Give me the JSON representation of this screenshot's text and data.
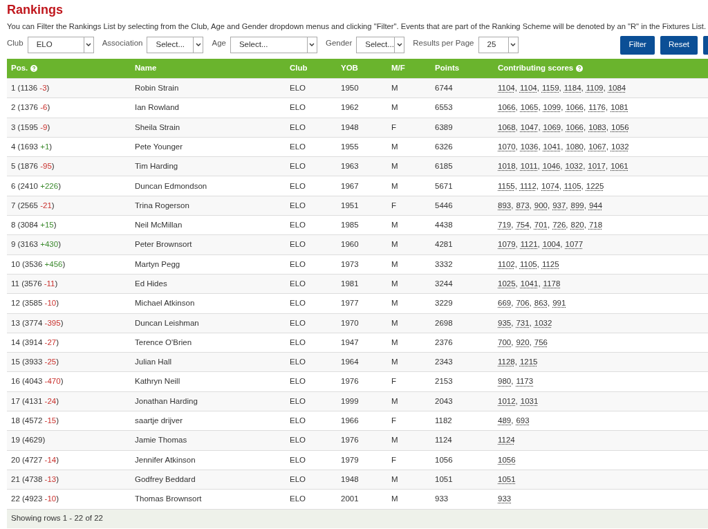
{
  "title": "Rankings",
  "intro": "You can Filter the Rankings List by selecting from the Club, Age and Gender dropdown menus and clicking \"Filter\". Events that are part of the Ranking Scheme will be denoted by an \"R\" in the Fixtures List.",
  "filters": [
    {
      "label": "Club",
      "value": "ELO"
    },
    {
      "label": "Association",
      "value": "Select..."
    },
    {
      "label": "Age",
      "value": "Select..."
    },
    {
      "label": "Gender",
      "value": "Select..."
    },
    {
      "label": "Results per Page",
      "value": "25"
    }
  ],
  "buttons": [
    "Filter",
    "Reset"
  ],
  "columns": [
    {
      "label": "Pos.",
      "help": true
    },
    {
      "label": "Name",
      "help": false
    },
    {
      "label": "Club",
      "help": false
    },
    {
      "label": "YOB",
      "help": false
    },
    {
      "label": "M/F",
      "help": false
    },
    {
      "label": "Points",
      "help": false
    },
    {
      "label": "Contributing scores",
      "help": true
    }
  ],
  "rows": [
    {
      "position": "1 (1136",
      "change": "-3",
      "kind": "down",
      "close": ")",
      "name": "Robin Strain",
      "club": "ELO",
      "yob": "1950",
      "sex": "M",
      "points": "6744",
      "scores": [
        {
          "value": "1104",
          "sep": ","
        },
        {
          "value": "1104",
          "sep": ","
        },
        {
          "value": "1159",
          "sep": ","
        },
        {
          "value": "1184",
          "sep": ","
        },
        {
          "value": "1109",
          "sep": ","
        },
        {
          "value": "1084"
        }
      ]
    },
    {
      "position": "2 (1376",
      "change": "-6",
      "kind": "down",
      "close": ")",
      "name": "Ian Rowland",
      "club": "ELO",
      "yob": "1962",
      "sex": "M",
      "points": "6553",
      "scores": [
        {
          "value": "1066",
          "sep": ","
        },
        {
          "value": "1065",
          "sep": ","
        },
        {
          "value": "1099",
          "sep": ","
        },
        {
          "value": "1066",
          "sep": ","
        },
        {
          "value": "1176",
          "sep": ","
        },
        {
          "value": "1081"
        }
      ]
    },
    {
      "position": "3 (1595",
      "change": "-9",
      "kind": "down",
      "close": ")",
      "name": "Sheila Strain",
      "club": "ELO",
      "yob": "1948",
      "sex": "F",
      "points": "6389",
      "scores": [
        {
          "value": "1068",
          "sep": ","
        },
        {
          "value": "1047",
          "sep": ","
        },
        {
          "value": "1069",
          "sep": ","
        },
        {
          "value": "1066",
          "sep": ","
        },
        {
          "value": "1083",
          "sep": ","
        },
        {
          "value": "1056"
        }
      ]
    },
    {
      "position": "4 (1693",
      "change": "+1",
      "kind": "up",
      "close": ")",
      "name": "Pete Younger",
      "club": "ELO",
      "yob": "1955",
      "sex": "M",
      "points": "6326",
      "scores": [
        {
          "value": "1070",
          "sep": ","
        },
        {
          "value": "1036",
          "sep": ","
        },
        {
          "value": "1041",
          "sep": ","
        },
        {
          "value": "1080",
          "sep": ","
        },
        {
          "value": "1067",
          "sep": ","
        },
        {
          "value": "1032"
        }
      ]
    },
    {
      "position": "5 (1876",
      "change": "-95",
      "kind": "down",
      "close": ")",
      "name": "Tim Harding",
      "club": "ELO",
      "yob": "1963",
      "sex": "M",
      "points": "6185",
      "scores": [
        {
          "value": "1018",
          "sep": ","
        },
        {
          "value": "1011",
          "sep": ","
        },
        {
          "value": "1046",
          "sep": ","
        },
        {
          "value": "1032",
          "sep": ","
        },
        {
          "value": "1017",
          "sep": ","
        },
        {
          "value": "1061"
        }
      ]
    },
    {
      "position": "6 (2410",
      "change": "+226",
      "kind": "up",
      "close": ")",
      "name": "Duncan Edmondson",
      "club": "ELO",
      "yob": "1967",
      "sex": "M",
      "points": "5671",
      "scores": [
        {
          "value": "1155",
          "sep": ","
        },
        {
          "value": "1112",
          "sep": ","
        },
        {
          "value": "1074",
          "sep": ","
        },
        {
          "value": "1105",
          "sep": ","
        },
        {
          "value": "1225"
        }
      ]
    },
    {
      "position": "7 (2565",
      "change": "-21",
      "kind": "down",
      "close": ")",
      "name": "Trina Rogerson",
      "club": "ELO",
      "yob": "1951",
      "sex": "F",
      "points": "5446",
      "scores": [
        {
          "value": "893",
          "sep": ","
        },
        {
          "value": "873",
          "sep": ","
        },
        {
          "value": "900",
          "sep": ","
        },
        {
          "value": "937",
          "sep": ","
        },
        {
          "value": "899",
          "sep": ","
        },
        {
          "value": "944"
        }
      ]
    },
    {
      "position": "8 (3084",
      "change": "+15",
      "kind": "up",
      "close": ")",
      "name": "Neil McMillan",
      "club": "ELO",
      "yob": "1985",
      "sex": "M",
      "points": "4438",
      "scores": [
        {
          "value": "719",
          "sep": ","
        },
        {
          "value": "754",
          "sep": ","
        },
        {
          "value": "701",
          "sep": ","
        },
        {
          "value": "726",
          "sep": ","
        },
        {
          "value": "820",
          "sep": ","
        },
        {
          "value": "718"
        }
      ]
    },
    {
      "position": "9 (3163",
      "change": "+430",
      "kind": "up",
      "close": ")",
      "name": "Peter Brownsort",
      "club": "ELO",
      "yob": "1960",
      "sex": "M",
      "points": "4281",
      "scores": [
        {
          "value": "1079",
          "sep": ","
        },
        {
          "value": "1121",
          "sep": ","
        },
        {
          "value": "1004",
          "sep": ","
        },
        {
          "value": "1077"
        }
      ]
    },
    {
      "position": "10 (3536",
      "change": "+456",
      "kind": "up",
      "close": ")",
      "name": "Martyn Pegg",
      "club": "ELO",
      "yob": "1973",
      "sex": "M",
      "points": "3332",
      "scores": [
        {
          "value": "1102",
          "sep": ","
        },
        {
          "value": "1105",
          "sep": ","
        },
        {
          "value": "1125"
        }
      ]
    },
    {
      "position": "11 (3576",
      "change": "-11",
      "kind": "down",
      "close": ")",
      "name": "Ed Hides",
      "club": "ELO",
      "yob": "1981",
      "sex": "M",
      "points": "3244",
      "scores": [
        {
          "value": "1025",
          "sep": ","
        },
        {
          "value": "1041",
          "sep": ","
        },
        {
          "value": "1178"
        }
      ]
    },
    {
      "position": "12 (3585",
      "change": "-10",
      "kind": "down",
      "close": ")",
      "name": "Michael Atkinson",
      "club": "ELO",
      "yob": "1977",
      "sex": "M",
      "points": "3229",
      "scores": [
        {
          "value": "669",
          "sep": ","
        },
        {
          "value": "706",
          "sep": ","
        },
        {
          "value": "863",
          "sep": ","
        },
        {
          "value": "991"
        }
      ]
    },
    {
      "position": "13 (3774",
      "change": "-395",
      "kind": "down",
      "close": ")",
      "name": "Duncan Leishman",
      "club": "ELO",
      "yob": "1970",
      "sex": "M",
      "points": "2698",
      "scores": [
        {
          "value": "935",
          "sep": ","
        },
        {
          "value": "731",
          "sep": ","
        },
        {
          "value": "1032"
        }
      ]
    },
    {
      "position": "14 (3914",
      "change": "-27",
      "kind": "down",
      "close": ")",
      "name": "Terence O'Brien",
      "club": "ELO",
      "yob": "1947",
      "sex": "M",
      "points": "2376",
      "scores": [
        {
          "value": "700",
          "sep": ","
        },
        {
          "value": "920",
          "sep": ","
        },
        {
          "value": "756"
        }
      ]
    },
    {
      "position": "15 (3933",
      "change": "-25",
      "kind": "down",
      "close": ")",
      "name": "Julian Hall",
      "club": "ELO",
      "yob": "1964",
      "sex": "M",
      "points": "2343",
      "scores": [
        {
          "value": "1128",
          "sep": ","
        },
        {
          "value": "1215"
        }
      ]
    },
    {
      "position": "16 (4043",
      "change": "-470",
      "kind": "down",
      "close": ")",
      "name": "Kathryn Neill",
      "club": "ELO",
      "yob": "1976",
      "sex": "F",
      "points": "2153",
      "scores": [
        {
          "value": "980",
          "sep": ","
        },
        {
          "value": "1173"
        }
      ]
    },
    {
      "position": "17 (4131",
      "change": "-24",
      "kind": "down",
      "close": ")",
      "name": "Jonathan Harding",
      "club": "ELO",
      "yob": "1999",
      "sex": "M",
      "points": "2043",
      "scores": [
        {
          "value": "1012",
          "sep": ","
        },
        {
          "value": "1031"
        }
      ]
    },
    {
      "position": "18 (4572",
      "change": "-15",
      "kind": "down",
      "close": ")",
      "name": "saartje drijver",
      "club": "ELO",
      "yob": "1966",
      "sex": "F",
      "points": "1182",
      "scores": [
        {
          "value": "489",
          "sep": ","
        },
        {
          "value": "693"
        }
      ]
    },
    {
      "position": "19 (4629)",
      "name": "Jamie Thomas",
      "club": "ELO",
      "yob": "1976",
      "sex": "M",
      "points": "1124",
      "scores": [
        {
          "value": "1124"
        }
      ]
    },
    {
      "position": "20 (4727",
      "change": "-14",
      "kind": "down",
      "close": ")",
      "name": "Jennifer Atkinson",
      "club": "ELO",
      "yob": "1979",
      "sex": "F",
      "points": "1056",
      "scores": [
        {
          "value": "1056"
        }
      ]
    },
    {
      "position": "21 (4738",
      "change": "-13",
      "kind": "down",
      "close": ")",
      "name": "Godfrey Beddard",
      "club": "ELO",
      "yob": "1948",
      "sex": "M",
      "points": "1051",
      "scores": [
        {
          "value": "1051"
        }
      ]
    },
    {
      "position": "22 (4923",
      "change": "-10",
      "kind": "down",
      "close": ")",
      "name": "Thomas Brownsort",
      "club": "ELO",
      "yob": "2001",
      "sex": "M",
      "points": "933",
      "scores": [
        {
          "value": "933"
        }
      ]
    }
  ],
  "footer": "Showing rows 1 - 22 of 22"
}
